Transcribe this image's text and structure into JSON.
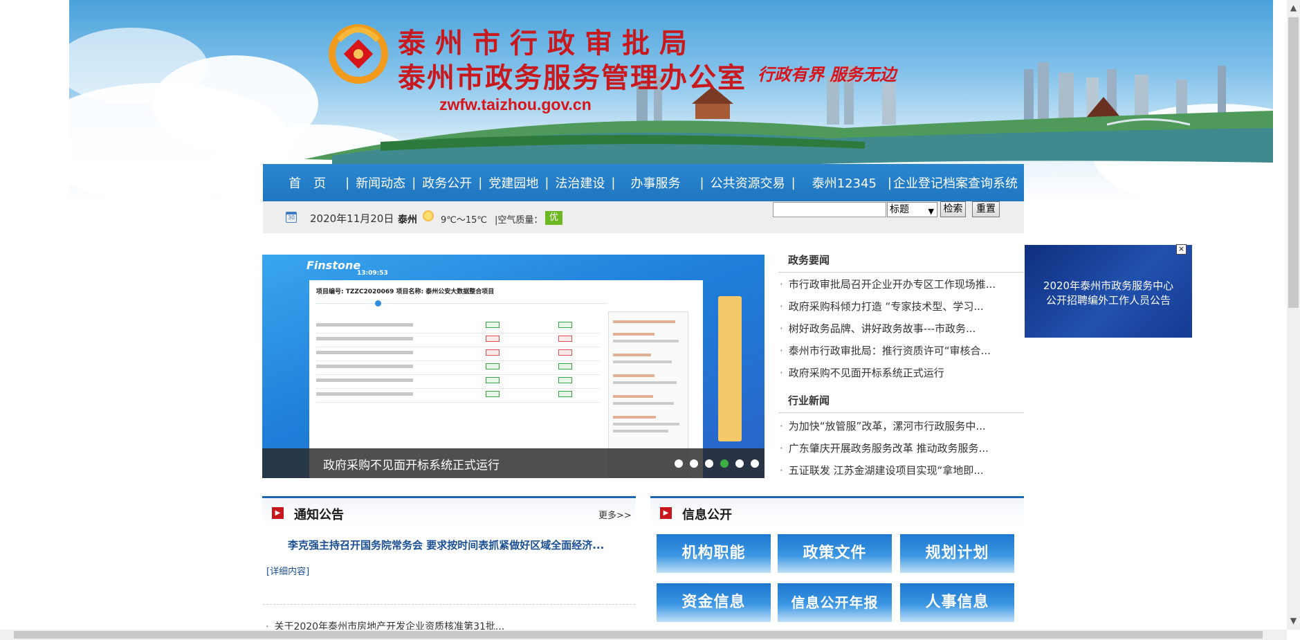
{
  "banner": {
    "title_line1": "泰州市行政审批局",
    "title_line2": "泰州市政务服务管理办公室",
    "slogan": "行政有界 服务无边",
    "domain": "zwfw.taizhou.gov.cn"
  },
  "nav": {
    "items": [
      "首　页",
      "新闻动态",
      "政务公开",
      "党建园地",
      "法治建设",
      "办事服务",
      "公共资源交易",
      "泰州12345",
      "企业登记档案查询系统"
    ],
    "separator": "|"
  },
  "info_bar": {
    "calendar_day": "30",
    "date": "2020年11月20日",
    "city": "泰州",
    "temperature": "9℃～15℃",
    "air_quality_label": "|空气质量：",
    "air_quality_value": "优",
    "air_quality_color": "#6cb921"
  },
  "search": {
    "input_value": "",
    "select_value": "标题",
    "search_button": "检索",
    "reset_button": "重置"
  },
  "slideshow": {
    "caption": "政府采购不见面开标系统正式运行",
    "brand": "Finstone",
    "time": "13:09:53",
    "project_line": "项目编号: TZZC2020069 项目名称: 泰州公安大数据整合项目",
    "dot_count": 6,
    "active_dot": 4
  },
  "news": {
    "section1_title": "政务要闻",
    "section1_items": [
      "市行政审批局召开企业开办专区工作现场推...",
      "政府采购科倾力打造 “专家技术型、学习...",
      "树好政务品牌、讲好政务故事---市政务...",
      "泰州市行政审批局：推行资质许可“审核合...",
      "政府采购不见面开标系统正式运行"
    ],
    "section2_title": "行业新闻",
    "section2_items": [
      "为加快“放管服”改革，漯河市行政服务中...",
      "广东肇庆开展政务服务改革 推动政务服务...",
      "五证联发 江苏金湖建设项目实现“拿地即..."
    ]
  },
  "popup": {
    "line1": "2020年泰州市政务服务中心",
    "line2": "公开招聘编外工作人员公告",
    "close_label": "×"
  },
  "notice": {
    "title": "通知公告",
    "more": "更多>>",
    "headline": "李克强主持召开国务院常务会 要求按时间表抓紧做好区域全面经济...",
    "detail_link": "[详细内容]",
    "items": [
      "关于2020年泰州市房地产开发企业资质核准第31批..."
    ]
  },
  "disclosure": {
    "title": "信息公开",
    "tiles": [
      "机构职能",
      "政策文件",
      "规划计划",
      "资金信息",
      "信息公开年报",
      "人事信息"
    ]
  },
  "colors": {
    "nav_blue": "#1f76c1",
    "title_red": "#c8191e",
    "link_blue": "#1a4f94",
    "section_icon_red": "#c8161e"
  },
  "icons": {
    "calendar": "calendar-icon",
    "weather": "sun-icon",
    "section": "square-arrow-icon",
    "close": "close-icon"
  }
}
